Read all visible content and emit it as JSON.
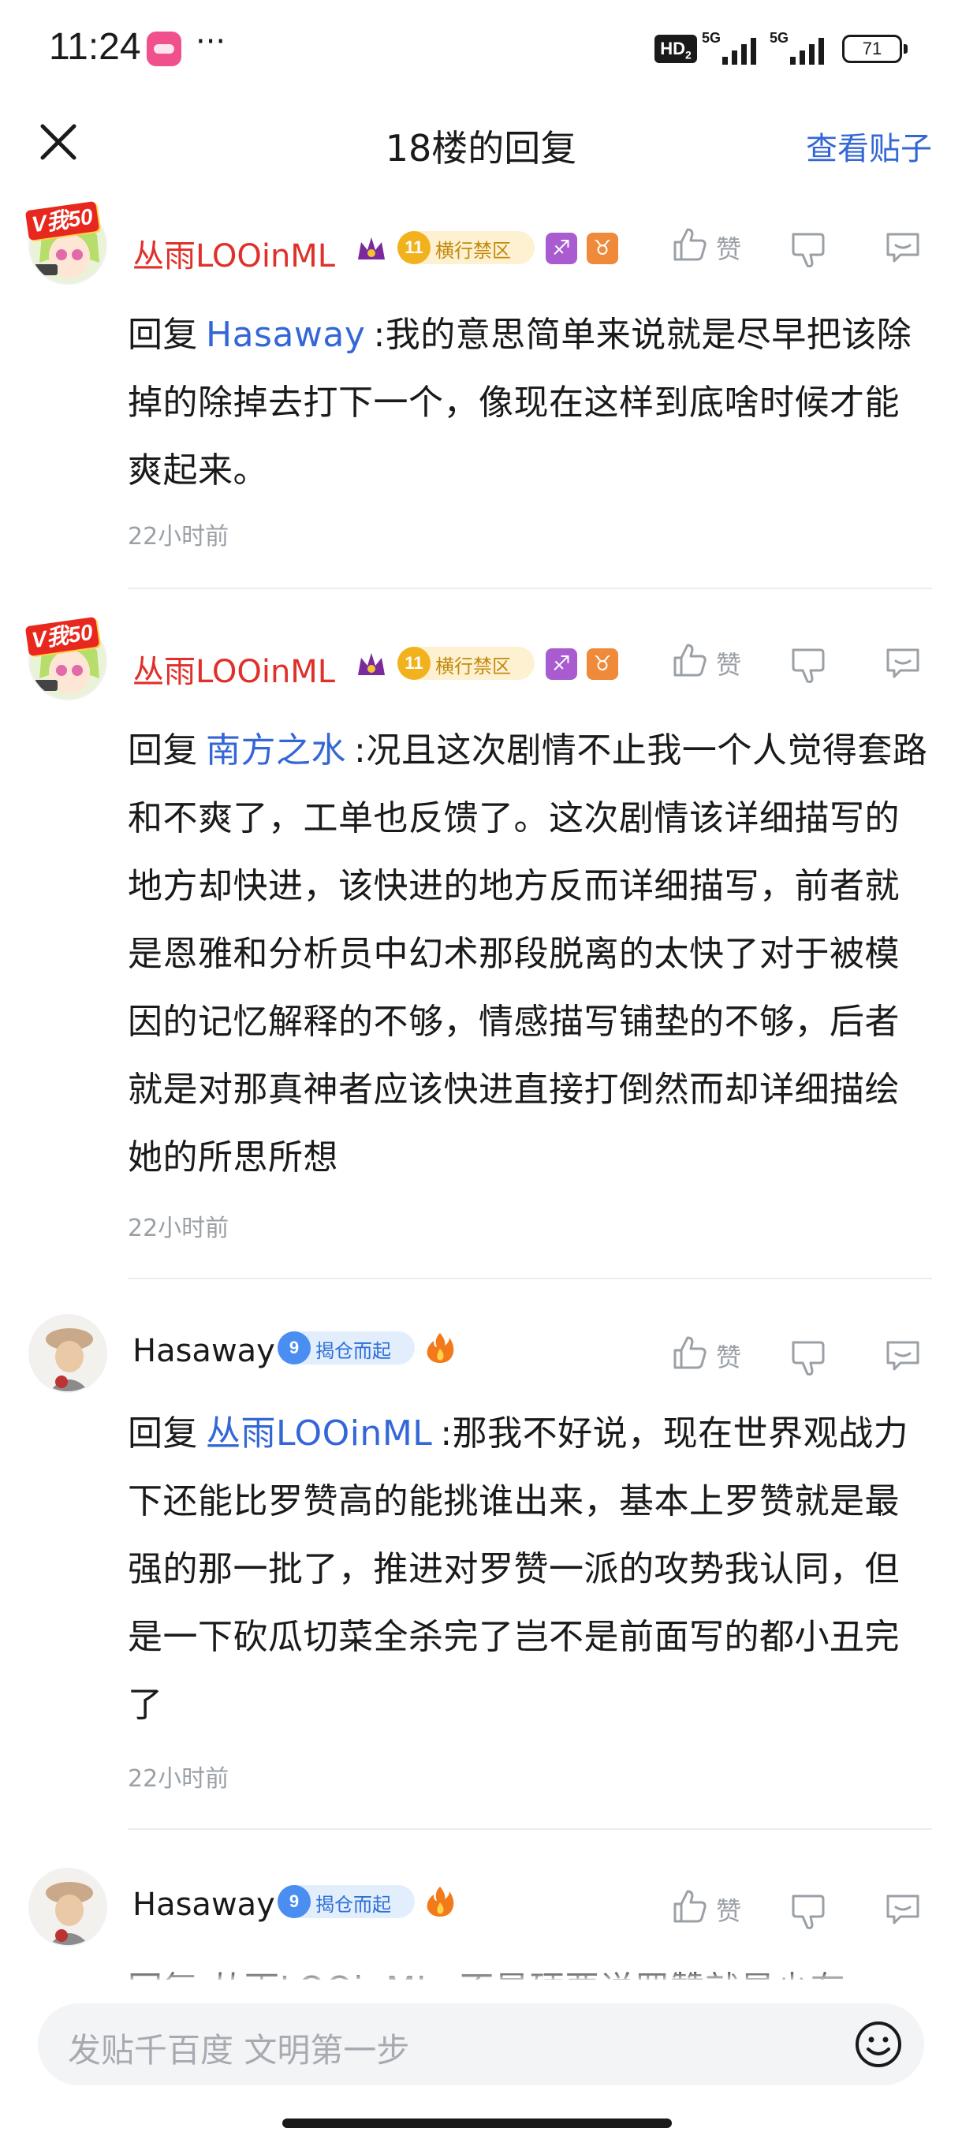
{
  "status_bar": {
    "time": "11:24",
    "dots": "···",
    "hd": "HD",
    "hd_sub": "2",
    "signal1": "5G",
    "signal2": "5G",
    "battery": "71"
  },
  "header": {
    "title": "18楼的回复",
    "view_post": "查看贴子",
    "close_icon": "close-icon"
  },
  "actions": {
    "like": "赞"
  },
  "replies": [
    {
      "username": "丛雨LOOinML",
      "v_badge": "V我50",
      "level": "11",
      "level_name": "横行禁区",
      "zodiac1": "♐",
      "zodiac2": "♉",
      "reply_prefix": "回复",
      "mention": "Hasaway",
      "text": ":我的意思简单来说就是尽早把该除掉的除掉去打下一个，像现在这样到底啥时候才能爽起来。",
      "time": "22小时前"
    },
    {
      "username": "丛雨LOOinML",
      "v_badge": "V我50",
      "level": "11",
      "level_name": "横行禁区",
      "zodiac1": "♐",
      "zodiac2": "♉",
      "reply_prefix": "回复",
      "mention": "南方之水",
      "text": ":况且这次剧情不止我一个人觉得套路和不爽了，工单也反馈了。这次剧情该详细描写的地方却快进，该快进的地方反而详细描写，前者就是恩雅和分析员中幻术那段脱离的太快了对于被模因的记忆解释的不够，情感描写铺垫的不够，后者就是对那真神者应该快进直接打倒然而却详细描绘她的所思所想",
      "time": "22小时前"
    },
    {
      "username": "Hasaway",
      "level": "9",
      "level_name": "揭仓而起",
      "reply_prefix": "回复",
      "mention": "丛雨LOOinML",
      "text": ":那我不好说，现在世界观战力下还能比罗赞高的能挑谁出来，基本上罗赞就是最强的那一批了，推进对罗赞一派的攻势我认同，但是一下砍瓜切菜全杀完了岂不是前面写的都小丑完了",
      "time": "22小时前"
    },
    {
      "username": "Hasaway",
      "level": "9",
      "level_name": "揭仓而起",
      "partial_text": "回复 丛雨LOOinML :不是硬要说罗赞就是少有"
    }
  ],
  "composer": {
    "placeholder": "发贴千百度 文明第一步"
  },
  "colors": {
    "accent_blue": "#3467d6",
    "username_red": "#e0302a",
    "muted": "#9aa0a6"
  }
}
